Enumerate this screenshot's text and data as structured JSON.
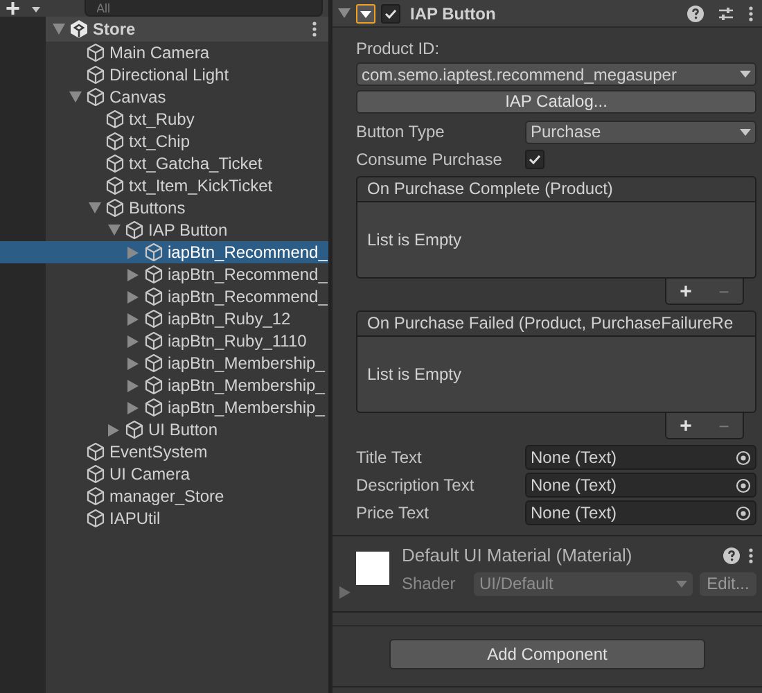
{
  "toolbar": {
    "add_label": "+",
    "search_placeholder": "All"
  },
  "tree": [
    {
      "name": "Store",
      "kind": "scene",
      "expanded": true,
      "selected": false,
      "children": [
        {
          "name": "Main Camera",
          "selected": false
        },
        {
          "name": "Directional Light",
          "selected": false
        },
        {
          "name": "Canvas",
          "expanded": true,
          "selected": false,
          "children": [
            {
              "name": "txt_Ruby",
              "selected": false
            },
            {
              "name": "txt_Chip",
              "selected": false
            },
            {
              "name": "txt_Gatcha_Ticket",
              "selected": false
            },
            {
              "name": "txt_Item_KickTicket",
              "selected": false
            },
            {
              "name": "Buttons",
              "expanded": true,
              "selected": false,
              "children": [
                {
                  "name": "IAP Button",
                  "expanded": true,
                  "selected": false,
                  "children": [
                    {
                      "name": "iapBtn_Recommend_",
                      "expanded": false,
                      "selected": true
                    },
                    {
                      "name": "iapBtn_Recommend_",
                      "expanded": false,
                      "selected": false
                    },
                    {
                      "name": "iapBtn_Recommend_",
                      "expanded": false,
                      "selected": false
                    },
                    {
                      "name": "iapBtn_Ruby_12",
                      "expanded": false,
                      "selected": false
                    },
                    {
                      "name": "iapBtn_Ruby_1110",
                      "expanded": false,
                      "selected": false
                    },
                    {
                      "name": "iapBtn_Membership_",
                      "expanded": false,
                      "selected": false
                    },
                    {
                      "name": "iapBtn_Membership_",
                      "expanded": false,
                      "selected": false
                    },
                    {
                      "name": "iapBtn_Membership_",
                      "expanded": false,
                      "selected": false
                    }
                  ]
                },
                {
                  "name": "UI Button",
                  "expanded": false,
                  "selected": false
                }
              ]
            }
          ]
        },
        {
          "name": "EventSystem",
          "selected": false
        },
        {
          "name": "UI Camera",
          "selected": false
        },
        {
          "name": "manager_Store",
          "selected": false
        },
        {
          "name": "IAPUtil",
          "selected": false
        }
      ]
    }
  ],
  "component": {
    "title": "IAP Button",
    "expanded": true,
    "enabled": true
  },
  "product_id": {
    "label": "Product ID:",
    "value": "com.semo.iaptest.recommend_megasuper"
  },
  "catalog_button": "IAP Catalog...",
  "button_type": {
    "label": "Button Type",
    "value": "Purchase"
  },
  "consume_purchase": {
    "label": "Consume Purchase",
    "checked": true
  },
  "events": [
    {
      "title": "On Purchase Complete (Product)",
      "empty_text": "List is Empty",
      "add": "+",
      "remove": "−"
    },
    {
      "title": "On Purchase Failed (Product, PurchaseFailureRe",
      "empty_text": "List is Empty",
      "add": "+",
      "remove": "−"
    }
  ],
  "object_fields": [
    {
      "label": "Title Text",
      "value": "None (Text)"
    },
    {
      "label": "Description Text",
      "value": "None (Text)"
    },
    {
      "label": "Price Text",
      "value": "None (Text)"
    }
  ],
  "material": {
    "title": "Default UI Material (Material)",
    "shader_label": "Shader",
    "shader_value": "UI/Default",
    "edit_button": "Edit...",
    "expanded": false
  },
  "add_component": "Add Component"
}
